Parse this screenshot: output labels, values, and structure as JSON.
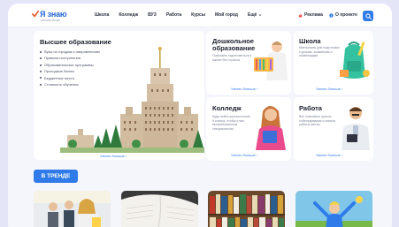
{
  "header": {
    "logo_title": "Я знаю",
    "logo_subtitle": "ЗНАНИЯ ВСЕМ",
    "nav": [
      "Школа",
      "Колледж",
      "ВУЗ",
      "Работа",
      "Курсы",
      "Мой город",
      "Ещё"
    ],
    "ads_label": "Реклама",
    "about_label": "О проекте"
  },
  "cards": {
    "higher": {
      "title": "Высшее образование",
      "items": [
        "Вузы по городам и направлениям",
        "Правила поступления",
        "Образовательные программы",
        "Проходные баллы",
        "Бюджетные места",
        "Стоимость обучения"
      ],
      "more": "Узнать больше"
    },
    "preschool": {
      "title": "Дошкольное образование",
      "desc": "Помогаем подготовиться к школе без стресса",
      "more": "Узнать больше"
    },
    "school": {
      "title": "Школа",
      "desc": "Материалы для подготовки к урокам, экзаменам и олимпиадам",
      "more": "Узнать больше"
    },
    "college": {
      "title": "Колледж",
      "desc": "Куда пойти учиться после 9 класса, чтобы стать востребованным специалистом",
      "more": "Узнать больше"
    },
    "work": {
      "title": "Работа",
      "desc": "Все ключевые пункты собеседования и поиски работы мечты",
      "more": "Узнать больше"
    }
  },
  "trending": {
    "label": "В ТРЕНДЕ"
  },
  "colors": {
    "accent": "#2f7be9",
    "page_bg": "#e4e6f7",
    "frame_bg": "#f5f6fb"
  },
  "icons": [
    "logo-tick-icon",
    "chevron-down-icon",
    "fire-icon",
    "info-icon",
    "search-icon",
    "chevron-right-icon"
  ]
}
